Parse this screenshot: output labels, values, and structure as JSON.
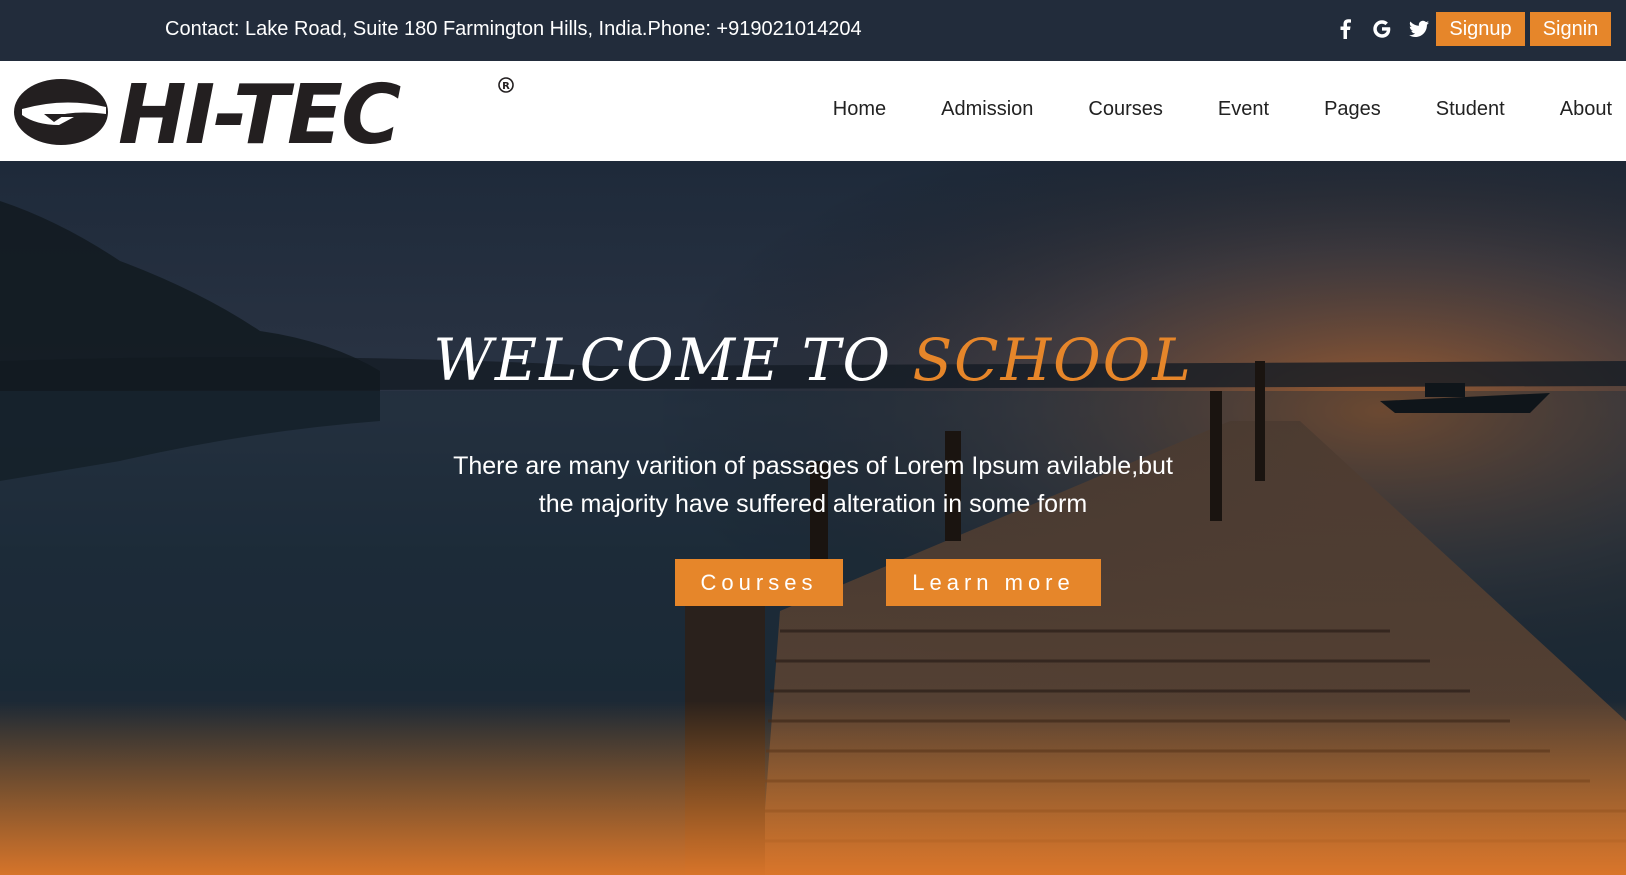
{
  "topbar": {
    "contact": "Contact: Lake Road, Suite 180 Farmington Hills, India.Phone: +919021014204",
    "social_icons": [
      "facebook-icon",
      "google-icon",
      "twitter-icon"
    ],
    "signup_label": "Signup",
    "signin_label": "Signin"
  },
  "header": {
    "logo_text": "HI-TEC",
    "logo_mark": "®",
    "nav": [
      "Home",
      "Admission",
      "Courses",
      "Event",
      "Pages",
      "Student",
      "About"
    ]
  },
  "hero": {
    "title_main": "WELCOME TO",
    "title_accent": "SCHOOL",
    "text_line1": "There are many varition of passages of Lorem Ipsum avilable,but",
    "text_line2": "the majority have suffered alteration in some form",
    "courses_button": "Courses",
    "learn_more_button": "Learn more"
  },
  "colors": {
    "accent": "#e6862a",
    "topbar_bg": "#222c3b"
  }
}
